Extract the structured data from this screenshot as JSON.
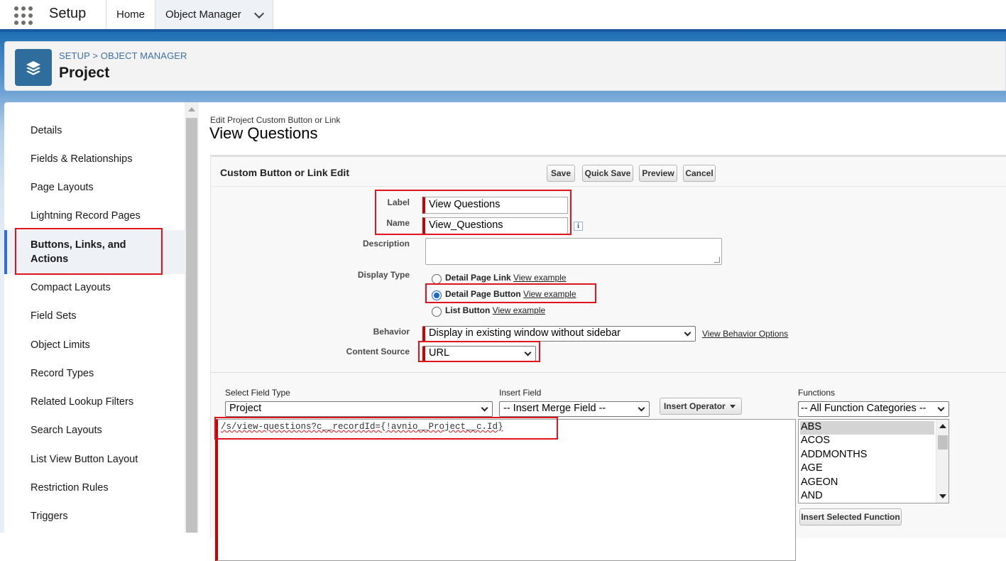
{
  "app": {
    "name": "Setup"
  },
  "nav": {
    "tabs": [
      {
        "label": "Home"
      },
      {
        "label": "Object Manager"
      }
    ]
  },
  "header": {
    "breadcrumb": {
      "setup": "SETUP",
      "separator": ">",
      "object_manager": "OBJECT MANAGER"
    },
    "title": "Project"
  },
  "sidebar": {
    "items": [
      {
        "label": "Details"
      },
      {
        "label": "Fields & Relationships"
      },
      {
        "label": "Page Layouts"
      },
      {
        "label": "Lightning Record Pages"
      },
      {
        "label_line1": "Buttons, Links, and",
        "label_line2": "Actions",
        "active": true
      },
      {
        "label": "Compact Layouts"
      },
      {
        "label": "Field Sets"
      },
      {
        "label": "Object Limits"
      },
      {
        "label": "Record Types"
      },
      {
        "label": "Related Lookup Filters"
      },
      {
        "label": "Search Layouts"
      },
      {
        "label": "List View Button Layout"
      },
      {
        "label": "Restriction Rules"
      },
      {
        "label": "Triggers"
      }
    ]
  },
  "main": {
    "subtitle": "Edit Project Custom Button or Link",
    "title": "View Questions",
    "panel_title": "Custom Button or Link Edit",
    "buttons": {
      "save": "Save",
      "quick_save": "Quick Save",
      "preview": "Preview",
      "cancel": "Cancel"
    },
    "form": {
      "label_label": "Label",
      "label_value": "View Questions",
      "name_label": "Name",
      "name_value": "View_Questions",
      "info_glyph": "i",
      "description_label": "Description",
      "display_type_label": "Display Type",
      "display_types": [
        {
          "label": "Detail Page Link",
          "example": "View example",
          "checked": false
        },
        {
          "label": "Detail Page Button",
          "example": "View example",
          "checked": true
        },
        {
          "label": "List Button",
          "example": "View example",
          "checked": false
        }
      ],
      "behavior_label": "Behavior",
      "behavior_value": "Display in existing window without sidebar",
      "behavior_options_link": "View Behavior Options",
      "content_source_label": "Content Source",
      "content_source_value": "URL"
    },
    "editor": {
      "field_type_label": "Select Field Type",
      "field_type_value": "Project",
      "insert_field_label": "Insert Field",
      "insert_field_value": "-- Insert Merge Field --",
      "insert_operator": "Insert Operator",
      "functions_label": "Functions",
      "function_category": "-- All Function Categories --",
      "functions": [
        "ABS",
        "ACOS",
        "ADDMONTHS",
        "AGE",
        "AGEON",
        "AND"
      ],
      "insert_function": "Insert Selected Function",
      "formula": "/s/view-questions?c__recordId={!avnio__Project__c.Id}"
    }
  },
  "colors": {
    "brand": "#1b5aa0",
    "highlight": "#e0141c",
    "required": "#cc0000",
    "active_nav": "#2f6ed6"
  }
}
